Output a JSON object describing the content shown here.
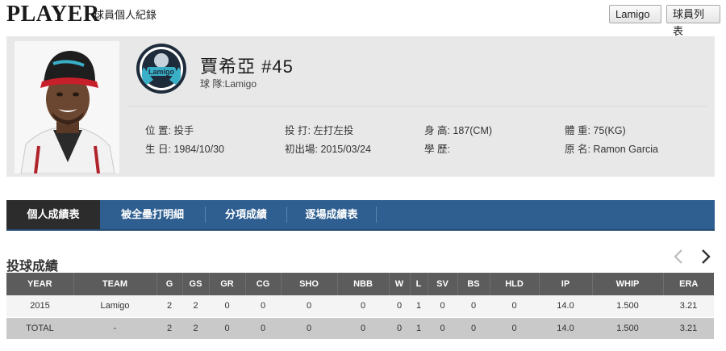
{
  "header": {
    "title": "PLAYER",
    "subtitle": "球員個人紀錄",
    "team_button": "Lamigo",
    "list_button": "球員列表"
  },
  "player": {
    "name": "賈希亞 #45",
    "team": "球 隊:Lamigo",
    "team_logo_label": "Lamigo",
    "info": {
      "position": "位 置: 投手",
      "bats_throws": "投 打: 左打左投",
      "height": "身 高: 187(CM)",
      "weight": "體 重: 75(KG)",
      "birthday": "生 日: 1984/10/30",
      "debut": "初出場: 2015/03/24",
      "education": "學 歷:",
      "original_name": "原 名: Ramon Garcia"
    }
  },
  "tabs": [
    "個人成績表",
    "被全壘打明細",
    "分項成績",
    "逐場成績表"
  ],
  "section": {
    "title": "投球成績"
  },
  "stats": {
    "columns": [
      "YEAR",
      "TEAM",
      "G",
      "GS",
      "GR",
      "CG",
      "SHO",
      "NBB",
      "W",
      "L",
      "SV",
      "BS",
      "HLD",
      "IP",
      "WHIP",
      "ERA"
    ],
    "rows": [
      [
        "2015",
        "Lamigo",
        "2",
        "2",
        "0",
        "0",
        "0",
        "0",
        "0",
        "1",
        "0",
        "0",
        "0",
        "14.0",
        "1.500",
        "3.21"
      ]
    ],
    "total": [
      "TOTAL",
      "-",
      "2",
      "2",
      "0",
      "0",
      "0",
      "0",
      "0",
      "1",
      "0",
      "0",
      "0",
      "14.0",
      "1.500",
      "3.21"
    ]
  },
  "colors": {
    "tab_bar": "#2f5f91",
    "tab_active": "#2c2c2c",
    "table_header": "#5c5c5c",
    "total_row": "#c9c9c9",
    "panel": "#e8e8e8"
  }
}
